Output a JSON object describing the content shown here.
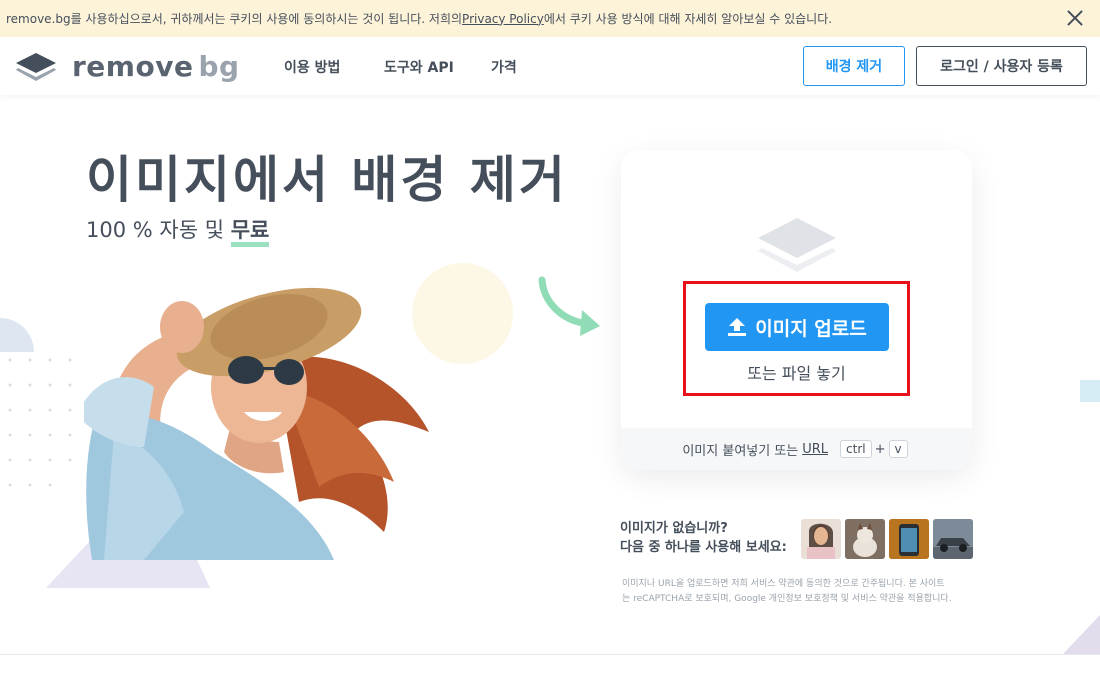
{
  "cookie_bar": {
    "text_before": "remove.bg를 사용하십으로서, 귀하께서는 쿠키의 사용에 동의하시는 것이 됩니다. 저희의 ",
    "link": "Privacy Policy",
    "text_after": "에서 쿠키 사용 방식에 대해 자세히 알아보실 수 있습니다."
  },
  "header": {
    "logo_main": "remove",
    "logo_accent": "bg",
    "nav": [
      "이용 방법",
      "도구와 API",
      "가격"
    ],
    "remove_bg_button": "배경 제거",
    "login_button": "로그인 / 사용자 등록"
  },
  "hero": {
    "title": "이미지에서 배경 제거",
    "subtitle_prefix": "100 % 자동 및 ",
    "subtitle_highlight": "무료"
  },
  "upload": {
    "button": "이미지 업로드",
    "drop_text": "또는 파일 놓기",
    "paste_text": "이미지 붙여넣기 또는",
    "paste_url": "URL",
    "key_ctrl": "ctrl",
    "key_plus": "+",
    "key_v": "v"
  },
  "samples": {
    "line1": "이미지가 없습니까?",
    "line2": "다음 중 하나를 사용해 보세요:",
    "thumbnails": [
      "woman-portrait",
      "cat",
      "phone",
      "car"
    ]
  },
  "terms": {
    "line1": "이미지나 URL을 업로드하면 저희 서비스 약관에 동의한 것으로 간주됩니다. 본 사이트",
    "line2": "는 reCAPTCHA로 보호되며, Google 개인정보 보호정책 및 서비스 약관을 적용합니다."
  },
  "colors": {
    "accent": "#2196f3",
    "text": "#454f5b",
    "highlight_underline": "#9be1c0",
    "annotation_box": "#e8101a"
  }
}
